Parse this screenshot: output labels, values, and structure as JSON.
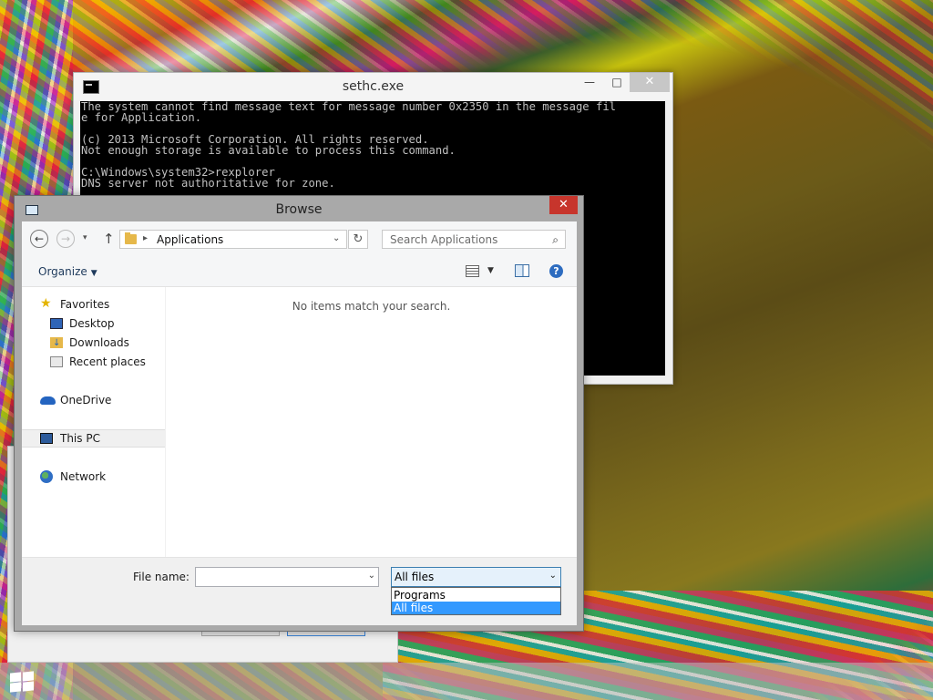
{
  "console": {
    "title": "sethc.exe",
    "buttons": {
      "minimize": "—",
      "maximize": "□",
      "close": "✕"
    },
    "output": "The system cannot find message text for message number 0x2350 in the message fil\ne for Application.\n\n(c) 2013 Microsoft Corporation. All rights reserved.\nNot enough storage is available to process this command.\n\nC:\\Windows\\system32>rexplorer\nDNS server not authoritative for zone."
  },
  "dialog": {
    "title": "Browse",
    "close": "✕",
    "address": {
      "separator": "▸",
      "location": "Applications",
      "dropdown": "⌄"
    },
    "refresh": "↻",
    "search": {
      "placeholder": "Search Applications"
    },
    "organize": "Organize",
    "nav": {
      "back": "←",
      "forward": "→",
      "recent": "▾",
      "up": "↑"
    },
    "sidebar": [
      {
        "label": "Favorites",
        "icon": "star-icon"
      },
      {
        "label": "Desktop",
        "icon": "desktop-icon"
      },
      {
        "label": "Downloads",
        "icon": "downloads-icon"
      },
      {
        "label": "Recent places",
        "icon": "recent-places-icon"
      },
      {
        "label": "OneDrive",
        "icon": "onedrive-icon"
      },
      {
        "label": "This PC",
        "icon": "computer-icon",
        "selected": true
      },
      {
        "label": "Network",
        "icon": "network-icon"
      }
    ],
    "empty_message": "No items match your search.",
    "file_name_label": "File name:",
    "file_name_value": "",
    "file_type": {
      "selected": "All files",
      "options": [
        "Programs",
        "All files"
      ],
      "highlighted_index": 1
    }
  },
  "colors": {
    "selection": "#3399ff",
    "close_red": "#c7352c",
    "console_bg": "#000000"
  }
}
